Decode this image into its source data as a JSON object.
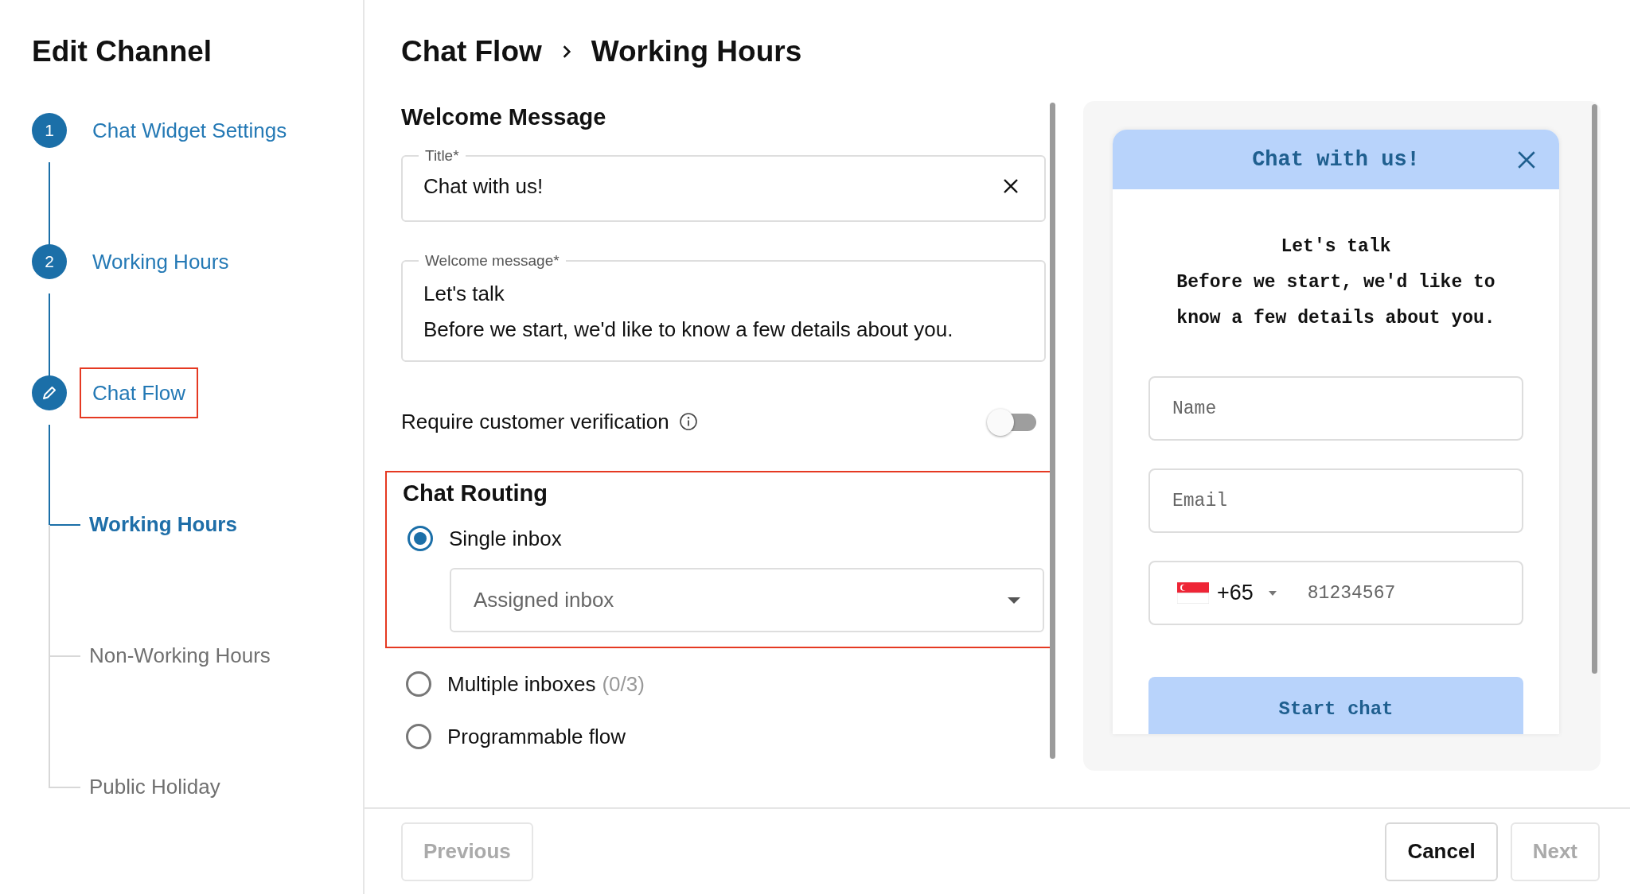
{
  "sidebar": {
    "title": "Edit Channel",
    "steps": [
      {
        "kind": "number",
        "number": "1",
        "label": "Chat Widget Settings",
        "highlighted": false
      },
      {
        "kind": "number",
        "number": "2",
        "label": "Working Hours",
        "highlighted": false
      },
      {
        "kind": "edit",
        "label": "Chat Flow",
        "highlighted": true
      }
    ],
    "substeps": [
      {
        "label": "Working Hours",
        "selected": true
      },
      {
        "label": "Non-Working Hours",
        "selected": false
      },
      {
        "label": "Public Holiday",
        "selected": false
      }
    ]
  },
  "breadcrumb": [
    "Chat Flow",
    "Working Hours"
  ],
  "welcome": {
    "heading": "Welcome Message",
    "title_field": {
      "label": "Title*",
      "value": "Chat with us!"
    },
    "message_field": {
      "label": "Welcome message*",
      "lines": [
        "Let's talk",
        "Before we start, we'd like to know a few details about you."
      ]
    }
  },
  "verification": {
    "label": "Require customer verification",
    "on": false
  },
  "routing": {
    "heading": "Chat Routing",
    "highlighted": true,
    "options": [
      {
        "label": "Single inbox",
        "selected": true
      },
      {
        "label": "Multiple inboxes",
        "count": "(0/3)",
        "selected": false
      },
      {
        "label": "Programmable flow",
        "selected": false
      }
    ],
    "dropdown": {
      "placeholder": "Assigned inbox"
    }
  },
  "preview": {
    "title": "Chat with us!",
    "lines": [
      "Let's talk",
      "Before we start, we'd like to know a few details about you."
    ],
    "fields": [
      {
        "kind": "text",
        "placeholder": "Name"
      },
      {
        "kind": "text",
        "placeholder": "Email"
      },
      {
        "kind": "phone",
        "code": "+65",
        "placeholder": "81234567"
      }
    ],
    "button": "Start chat"
  },
  "footer": {
    "previous": {
      "label": "Previous",
      "disabled": true
    },
    "cancel": {
      "label": "Cancel",
      "disabled": false
    },
    "next": {
      "label": "Next",
      "disabled": true
    }
  }
}
